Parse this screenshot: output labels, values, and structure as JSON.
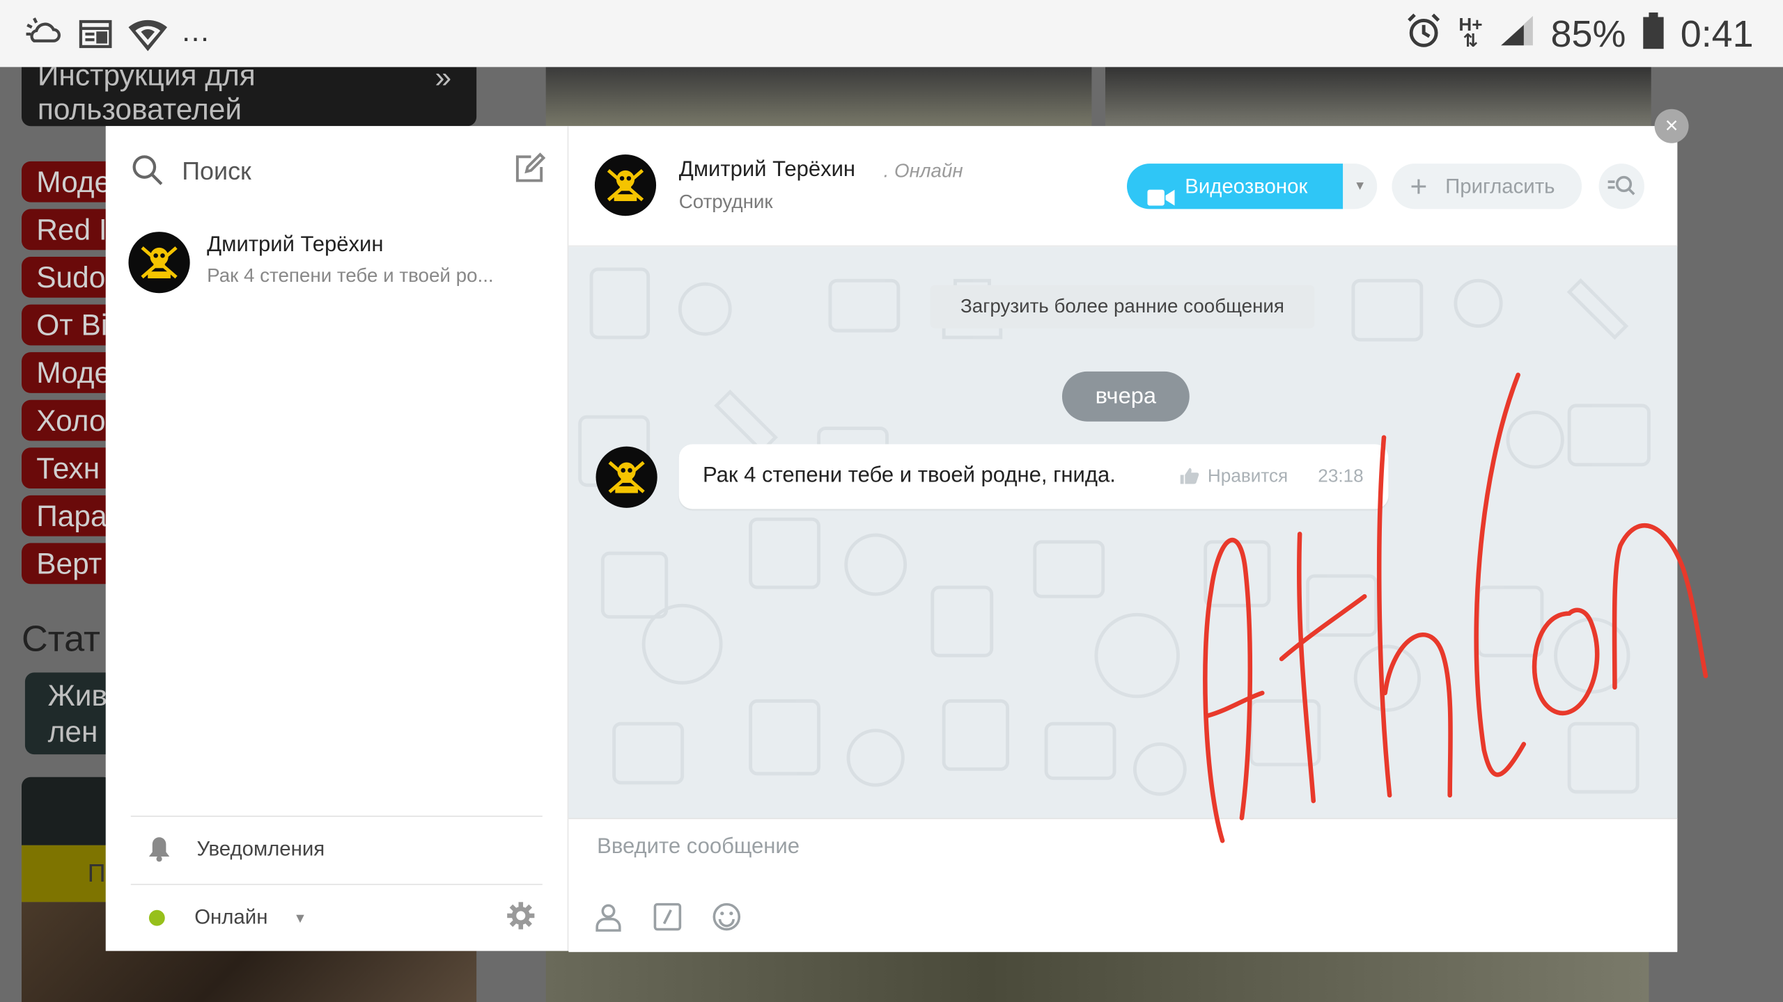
{
  "status_bar": {
    "left_icons": [
      "weather-icon",
      "news-icon",
      "wifi-icon"
    ],
    "overflow": "...",
    "right_icons": [
      "alarm-icon",
      "network-hplus-icon",
      "signal-icon",
      "battery-icon"
    ],
    "network": "H+",
    "battery": "85%",
    "time": "0:41"
  },
  "background_page": {
    "banner_line1": "Инструкция для",
    "banner_line2": "пользователей",
    "banner_arrow": "»",
    "menu_items": [
      "Моде",
      "Red I",
      "Sudo",
      "От Ві",
      "Моде",
      "Холо",
      "Техн",
      "Пара",
      "Верт"
    ],
    "section_heading": "Стат",
    "live_line1": "Жив",
    "live_line2": "лен",
    "yellow_text": "П"
  },
  "messenger": {
    "close": "×",
    "search_label": "Поиск",
    "chats": [
      {
        "name": "Дмитрий Терёхин",
        "preview": "Рак 4 степени тебе и твоей ро..."
      }
    ],
    "notifications_label": "Уведомления",
    "status_label": "Онлайн",
    "header": {
      "name": "Дмитрий Терёхин",
      "online": ". Онлайн",
      "role": "Сотрудник",
      "video_call_label": "Видеозвонок",
      "invite_label": "Пригласить"
    },
    "load_earlier": "Загрузить более ранние сообщения",
    "date_divider": "вчера",
    "messages": [
      {
        "text": "Рак 4 степени тебе и твоей родне, гнида.",
        "like_label": "Нравится",
        "time": "23:18"
      }
    ],
    "composer_placeholder": "Введите сообщение",
    "composer_tools": [
      "user-mention-icon",
      "command-icon",
      "emoji-icon"
    ]
  },
  "annotation": {
    "handwritten": "Athlon",
    "color": "#e8392b"
  },
  "colors": {
    "accent": "#2fc6f6",
    "online": "#97c01b",
    "date_pill": "#8d959b",
    "menu_red": "#6a0a0a"
  }
}
